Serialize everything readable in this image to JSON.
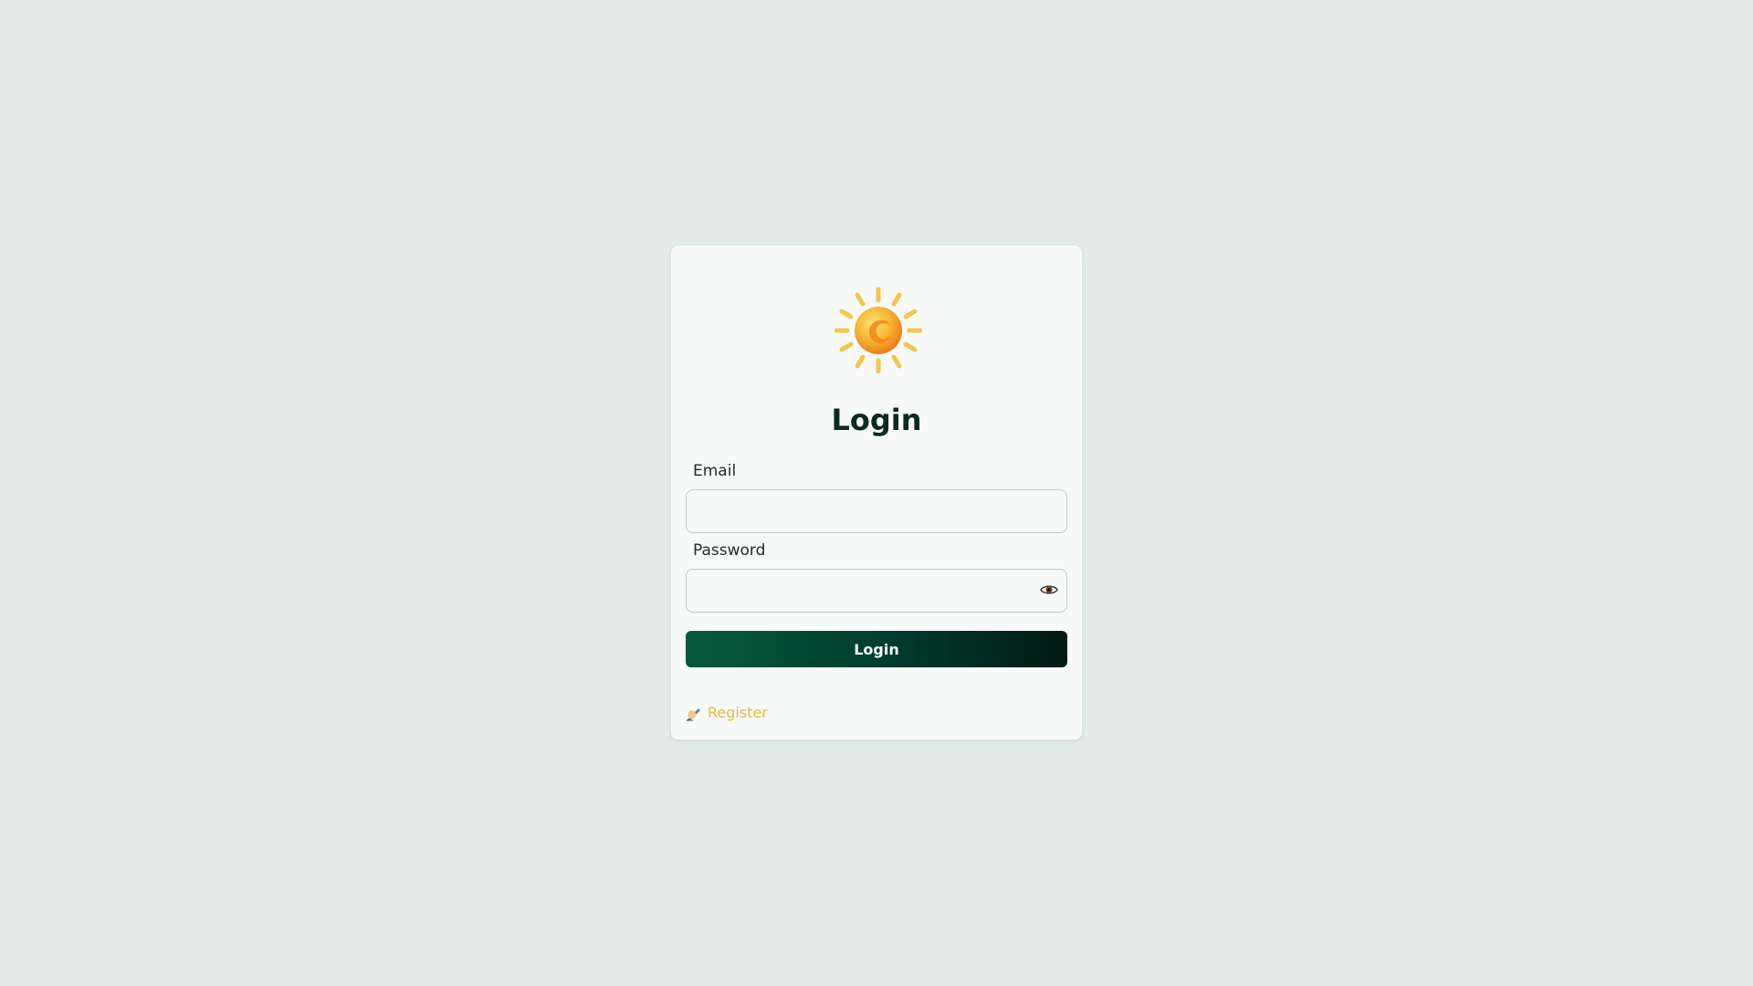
{
  "login": {
    "title": "Login",
    "email_label": "Email",
    "email_value": "",
    "password_label": "Password",
    "password_value": "",
    "submit_label": "Login",
    "register_label": "Register",
    "logo_icon": "sun-icon",
    "show_password_icon": "eye-icon",
    "register_icon": "writing-hand-icon"
  },
  "colors": {
    "background": "#e2ebe8",
    "card": "#f8faf9",
    "title": "#0c2a22",
    "button_start": "#065a3c",
    "button_end": "#001a14",
    "link": "#e5b93a",
    "sun_rays": "#f7c548",
    "sun_core": "#f39a1f"
  }
}
